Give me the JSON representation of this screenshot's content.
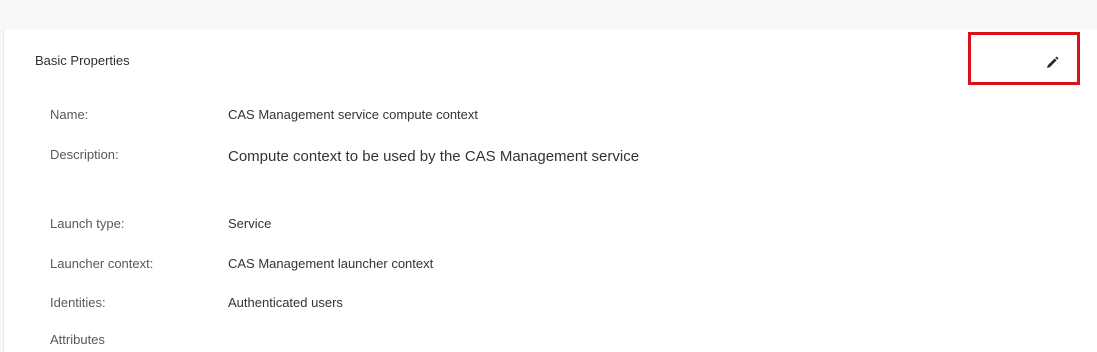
{
  "section": {
    "title": "Basic Properties",
    "edit_icon": "pencil-icon",
    "highlight_color": "#d9121a"
  },
  "properties": {
    "name": {
      "label": "Name:",
      "value": "CAS Management service compute context"
    },
    "description": {
      "label": "Description:",
      "value": "Compute context to be used by the CAS Management service"
    },
    "launch_type": {
      "label": "Launch type:",
      "value": "Service"
    },
    "launcher_context": {
      "label": "Launcher context:",
      "value": "CAS Management launcher context"
    },
    "identities": {
      "label": "Identities:",
      "value": "Authenticated users"
    },
    "attributes": {
      "label": "Attributes"
    }
  }
}
